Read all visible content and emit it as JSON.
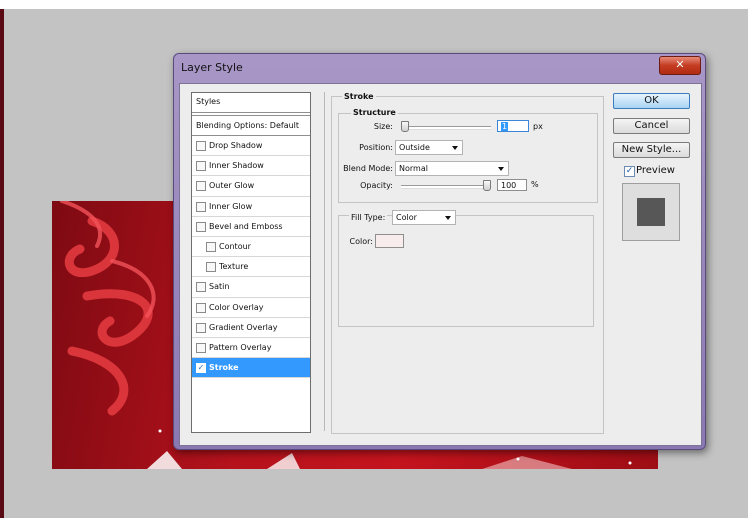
{
  "dialog": {
    "title": "Layer Style",
    "close_icon": "close-icon",
    "close_glyph": "✕"
  },
  "styles_list": {
    "header": "Styles",
    "blending_options": "Blending Options: Default",
    "items": [
      {
        "label": "Drop Shadow",
        "checked": false,
        "indent": false
      },
      {
        "label": "Inner Shadow",
        "checked": false,
        "indent": false
      },
      {
        "label": "Outer Glow",
        "checked": false,
        "indent": false
      },
      {
        "label": "Inner Glow",
        "checked": false,
        "indent": false
      },
      {
        "label": "Bevel and Emboss",
        "checked": false,
        "indent": false
      },
      {
        "label": "Contour",
        "checked": false,
        "indent": true
      },
      {
        "label": "Texture",
        "checked": false,
        "indent": true
      },
      {
        "label": "Satin",
        "checked": false,
        "indent": false
      },
      {
        "label": "Color Overlay",
        "checked": false,
        "indent": false
      },
      {
        "label": "Gradient Overlay",
        "checked": false,
        "indent": false
      },
      {
        "label": "Pattern Overlay",
        "checked": false,
        "indent": false
      },
      {
        "label": "Stroke",
        "checked": true,
        "indent": false,
        "selected": true
      }
    ]
  },
  "stroke": {
    "section_title": "Stroke",
    "structure_title": "Structure",
    "size_label": "Size:",
    "size_value": "1",
    "size_unit": "px",
    "position_label": "Position:",
    "position_value": "Outside",
    "blend_mode_label": "Blend Mode:",
    "blend_mode_value": "Normal",
    "opacity_label": "Opacity:",
    "opacity_value": "100",
    "opacity_unit": "%",
    "fill_type_label": "Fill Type:",
    "fill_type_value": "Color",
    "color_label": "Color:",
    "color_swatch": "#f8ecec"
  },
  "buttons": {
    "ok": "OK",
    "cancel": "Cancel",
    "new_style": "New Style...",
    "preview_label": "Preview",
    "preview_checked": true
  },
  "colors": {
    "selection": "#3399ff",
    "title_bar": "#9a88bd",
    "canvas_red": "#b5121c"
  }
}
